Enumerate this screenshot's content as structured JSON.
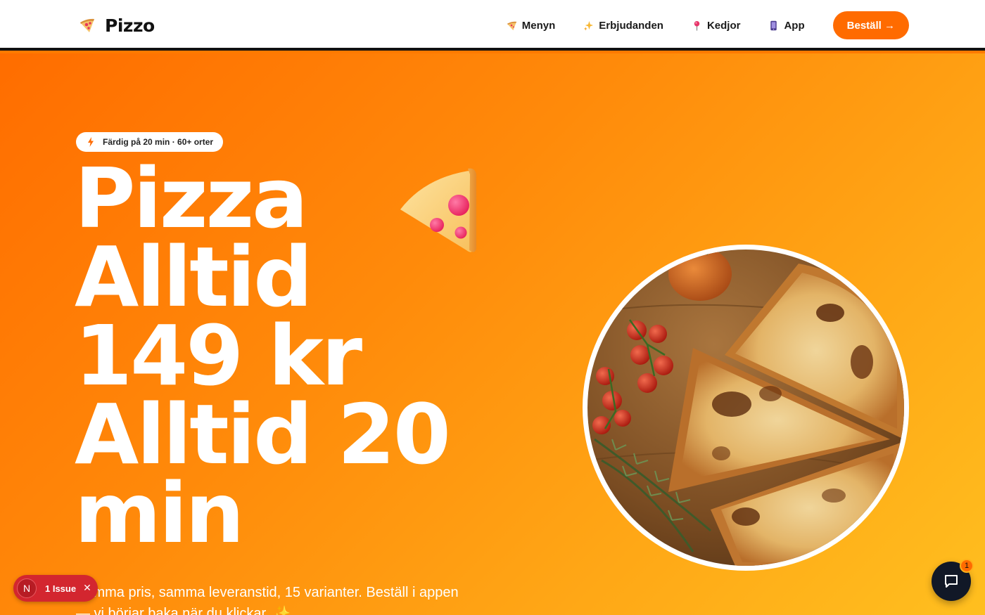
{
  "brand": {
    "name": "Pizzo",
    "logo_icon": "pizza-slice-icon"
  },
  "nav": {
    "items": [
      {
        "label": "Menyn",
        "icon": "pizza-slice-icon"
      },
      {
        "label": "Erbjudanden",
        "icon": "sparkles-icon"
      },
      {
        "label": "Kedjor",
        "icon": "pin-icon"
      },
      {
        "label": "App",
        "icon": "phone-icon"
      }
    ],
    "cta_label": "Beställ →"
  },
  "hero": {
    "badge": "Färdig på 20 min · 60+ orter",
    "headline_lines": [
      "Pizza",
      "Alltid",
      "149 kr",
      "Alltid 20",
      "min"
    ],
    "subtitle": "Samma pris, samma leveranstid, 15 varianter. Beställ i appen — vi börjar baka när du klickar. ✨"
  },
  "overlay": {
    "issue_avatar": "N",
    "issue_text": "1 Issue",
    "chat_badge": "1"
  },
  "colors": {
    "accent": "#ff6b00",
    "hero_start": "#ff6d00",
    "hero_end": "#ffbf1f",
    "issue_red": "#d3262f",
    "chat_dark": "#111827"
  }
}
